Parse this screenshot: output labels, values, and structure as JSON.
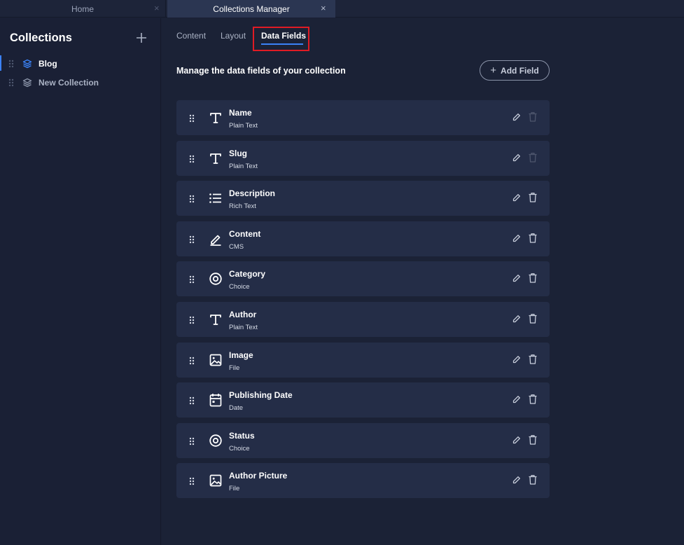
{
  "tabs": {
    "home": {
      "label": "Home",
      "close": "×"
    },
    "collections_manager": {
      "label": "Collections Manager",
      "close": "×"
    }
  },
  "sidebar": {
    "title": "Collections",
    "items": [
      {
        "label": "Blog",
        "active": true
      },
      {
        "label": "New Collection",
        "active": false
      }
    ]
  },
  "content_tabs": [
    {
      "label": "Content"
    },
    {
      "label": "Layout"
    },
    {
      "label": "Data Fields",
      "selected": true
    }
  ],
  "main": {
    "heading": "Manage the data fields of your collection",
    "add_field_label": "Add Field",
    "add_field_icon": "+"
  },
  "fields": [
    {
      "name": "Name",
      "type": "Plain Text",
      "icon": "text-icon",
      "deletable": false
    },
    {
      "name": "Slug",
      "type": "Plain Text",
      "icon": "text-icon",
      "deletable": false
    },
    {
      "name": "Description",
      "type": "Rich Text",
      "icon": "list-icon",
      "deletable": true
    },
    {
      "name": "Content",
      "type": "CMS",
      "icon": "pen-icon",
      "deletable": true
    },
    {
      "name": "Category",
      "type": "Choice",
      "icon": "choice-icon",
      "deletable": true
    },
    {
      "name": "Author",
      "type": "Plain Text",
      "icon": "text-icon",
      "deletable": true
    },
    {
      "name": "Image",
      "type": "File",
      "icon": "image-icon",
      "deletable": true
    },
    {
      "name": "Publishing Date",
      "type": "Date",
      "icon": "calendar-icon",
      "deletable": true
    },
    {
      "name": "Status",
      "type": "Choice",
      "icon": "choice-icon",
      "deletable": true
    },
    {
      "name": "Author Picture",
      "type": "File",
      "icon": "image-icon",
      "deletable": true
    }
  ],
  "colors": {
    "accent": "#3b82f6",
    "highlight_border": "#e01b24",
    "row_background": "#242d47",
    "page_background": "#1a2035"
  }
}
